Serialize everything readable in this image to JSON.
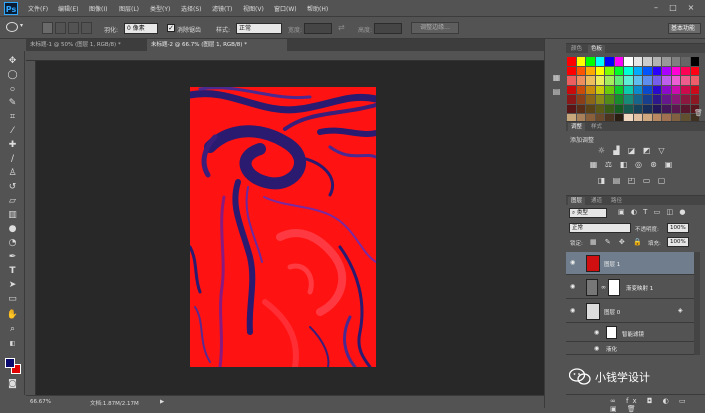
{
  "app": {
    "logo": "Ps"
  },
  "menu": [
    "文件(F)",
    "编辑(E)",
    "图像(I)",
    "图层(L)",
    "类型(Y)",
    "选择(S)",
    "滤镜(T)",
    "视图(V)",
    "窗口(W)",
    "帮助(H)"
  ],
  "window_controls": {
    "minimize": "–",
    "maximize": "□",
    "close": "×"
  },
  "options": {
    "feather_label": "羽化:",
    "feather_value": "0 像素",
    "antialias_label": "消除锯齿",
    "antialias_checked": true,
    "style_label": "样式:",
    "style_value": "正常",
    "width_label": "宽度:",
    "height_label": "高度:",
    "refine_edge": "调整边缘...",
    "workspace": "基本功能"
  },
  "tabs": [
    {
      "label": "未标题-1 @ 50% (图层 1, RGB/8) *",
      "active": false
    },
    {
      "label": "未标题-2 @ 66.7% (图层 1, RGB/8) *",
      "active": true
    }
  ],
  "status": {
    "zoom": "66.67%",
    "doc": "文档:1.87M/2.17M"
  },
  "panels": {
    "color_tab": "颜色",
    "swatches_tab": "色板",
    "adjust_tab": "调整",
    "styles_tab": "样式",
    "add_adjustment": "添加调整",
    "layers_tab": "图层",
    "channels_tab": "通道",
    "paths_tab": "路径"
  },
  "layers_panel": {
    "kind": "类型",
    "blend_mode": "正常",
    "opacity_label": "不透明度:",
    "opacity_value": "100%",
    "lock_label": "锁定:",
    "fill_label": "填充:",
    "fill_value": "100%"
  },
  "layers": [
    {
      "name": "图层 1",
      "selected": true
    },
    {
      "name": "渐变映射 1",
      "selected": false
    },
    {
      "name": "图层 0",
      "selected": false
    },
    {
      "name": "智能滤镜",
      "selected": false
    },
    {
      "name": "液化",
      "selected": false
    }
  ],
  "watermark": "小钱学设计",
  "colors": {
    "foreground": "#0a0a6e",
    "background": "#e00000",
    "canvas_red": "#ff1010",
    "canvas_navy": "#2a1a70"
  }
}
